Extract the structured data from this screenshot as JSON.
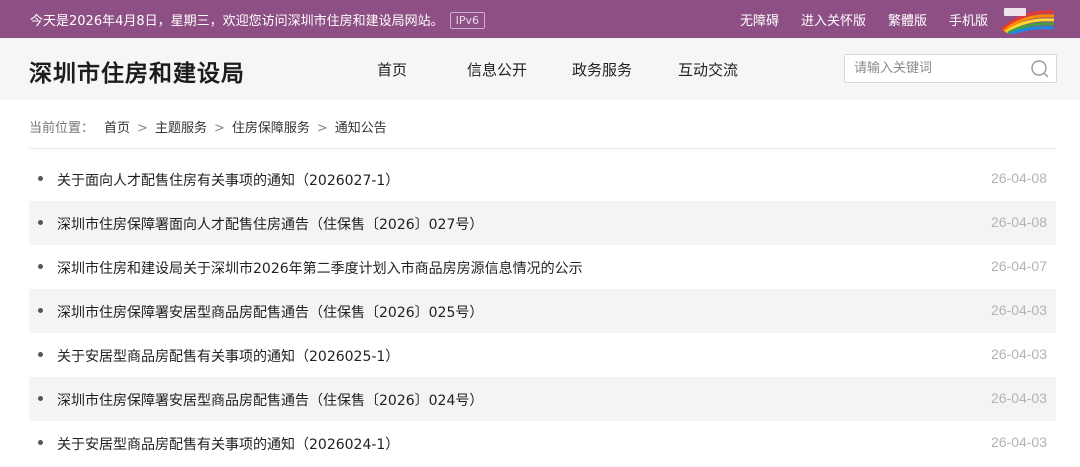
{
  "topbar": {
    "welcome": "今天是2026年4月8日，星期三，欢迎您访问深圳市住房和建设局网站。",
    "ipv6": "IPv6",
    "links": [
      "无障碍",
      "进入关怀版",
      "繁體版",
      "手机版"
    ]
  },
  "header": {
    "site_title": "深圳市住房和建设局",
    "nav": [
      "首页",
      "信息公开",
      "政务服务",
      "互动交流"
    ],
    "search_placeholder": "请输入关键词"
  },
  "breadcrumb": {
    "label": "当前位置：",
    "items": [
      "首页",
      "主题服务",
      "住房保障服务",
      "通知公告"
    ],
    "separator": ">"
  },
  "notices": [
    {
      "title": "关于面向人才配售住房有关事项的通知（2026027-1）",
      "date": "26-04-08"
    },
    {
      "title": "深圳市住房保障署面向人才配售住房通告（住保售〔2026〕027号）",
      "date": "26-04-08"
    },
    {
      "title": "深圳市住房和建设局关于深圳市2026年第二季度计划入市商品房房源信息情况的公示",
      "date": "26-04-07"
    },
    {
      "title": "深圳市住房保障署安居型商品房配售通告（住保售〔2026〕025号）",
      "date": "26-04-03"
    },
    {
      "title": "关于安居型商品房配售有关事项的通知（2026025-1）",
      "date": "26-04-03"
    },
    {
      "title": "深圳市住房保障署安居型商品房配售通告（住保售〔2026〕024号）",
      "date": "26-04-03"
    },
    {
      "title": "关于安居型商品房配售有关事项的通知（2026024-1）",
      "date": "26-04-03"
    }
  ],
  "colors": {
    "topbar_bg": "#8e4f85",
    "header_bg": "#f6f6f6",
    "alt_row_bg": "#f4f4f4",
    "date_color": "#b3b3b3"
  }
}
